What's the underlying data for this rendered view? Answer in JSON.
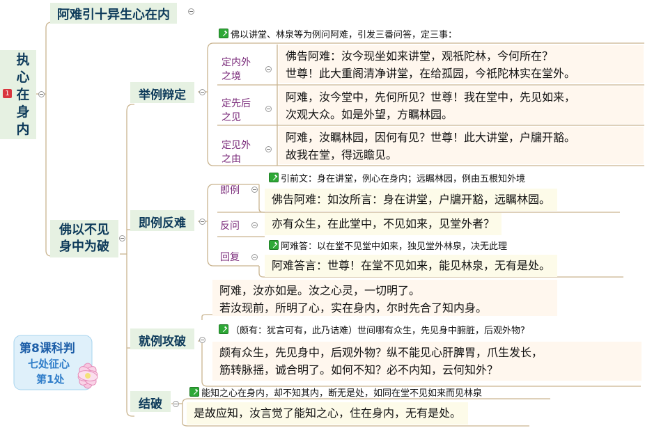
{
  "root": {
    "text": "执心在身内",
    "chars": [
      "执",
      "心",
      "在",
      "身",
      "内"
    ],
    "badge": "1"
  },
  "top_branch": {
    "text": "阿难引十异生心在内"
  },
  "branch_main": {
    "text_line1": "佛以不见",
    "text_line2": "身中为破"
  },
  "sec1": {
    "title": "举例辩定",
    "note": "佛以讲堂、林泉等为例问阿难，引发三番问答，定三事：",
    "items": [
      {
        "label1": "定内外",
        "label2": "之境",
        "line1": "佛告阿难：汝今现坐如来讲堂，观祇陀林，今何所在？",
        "line2": "世尊！此大重阁清净讲堂，在给孤园，今祇陀林实在堂外。"
      },
      {
        "label1": "定先后",
        "label2": "之见",
        "line1": "阿难，汝今堂中，先何所见？世尊！我在堂中，先见如来，",
        "line2": "次观大众。如是外望，方瞩林园。"
      },
      {
        "label1": "定见外",
        "label2": "之由",
        "line1": "阿难，汝瞩林园，因何有见？世尊！此大讲堂，户牖开豁。",
        "line2": "故我在堂，得远瞻见。"
      }
    ]
  },
  "sec2": {
    "title": "即例反难",
    "items": [
      {
        "label": "即例",
        "note": "引前文：身在讲堂，例心在身内；远瞩林园，例由五根知外境",
        "text": "佛告阿难：如汝所言：身在讲堂，户牖开豁，远瞩林园。"
      },
      {
        "label": "反问",
        "text": "亦有众生，在此堂中，不见如来，见堂外者？"
      },
      {
        "label": "回复",
        "note": "阿难答：以在堂不见堂中如来，独见堂外林泉，决无此理",
        "text": "阿难答言：世尊！在堂不见如来，能见林泉，无有是处。"
      }
    ]
  },
  "sec3": {
    "title": "就例攻破",
    "line1": "阿难，汝亦如是。汝之心灵，一切明了。",
    "line2": "若汝现前，所明了心，实在身内，尔时先合了知内身。",
    "note": "（颇有：犹言可有，此乃诘难）世间哪有众生，先见身中腑脏，后观外物?",
    "line3": "颇有众生，先见身中，后观外物？纵不能见心肝脾胃，爪生发长，",
    "line4": "筋转脉摇，诚合明了。如何不知？必不内知，云何知外？"
  },
  "sec4": {
    "title": "结破",
    "note": "能知之心在身内，却不知其内，断无是处，如同在堂不见如来而见林泉",
    "text": "是故应知，汝言觉了能知之心，住在身内，无有是处。"
  },
  "logo": {
    "line1": "第8课科判",
    "line2": "七处征心",
    "line3": "第1处"
  },
  "colors": {
    "branch_bg": "#e6f1e2",
    "branch_text": "#0d3a5a",
    "leaf_bg": "#fff7ee",
    "leaf_alt_bg": "#fdfbe9",
    "label_text": "#7a2a7a",
    "line": "#c8b89a",
    "badge": "#d9363e"
  }
}
